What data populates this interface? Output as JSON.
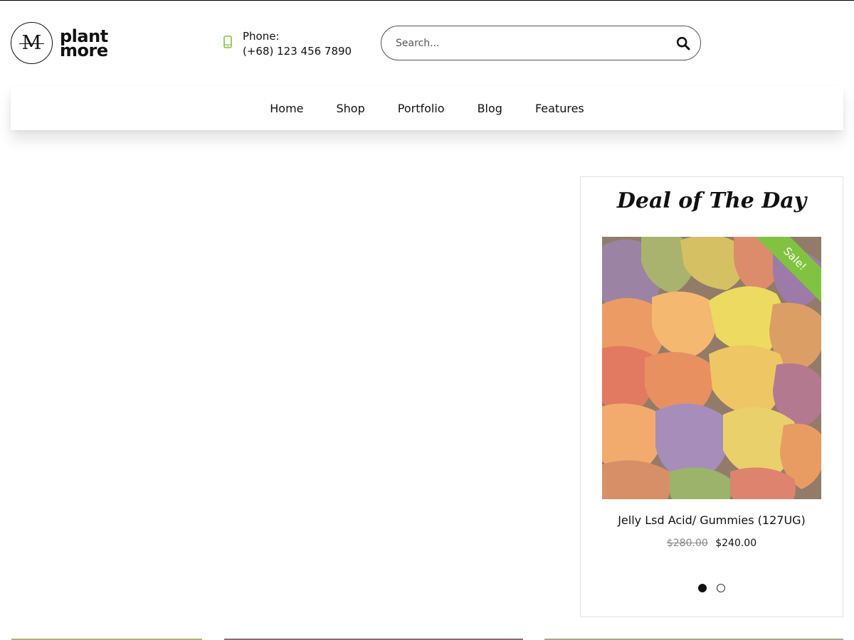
{
  "brand": {
    "logo_letter": "M",
    "name_line1": "plant",
    "name_line2": "more"
  },
  "contact": {
    "label": "Phone:",
    "number": "(+68) 123 456 7890",
    "icon": "mobile-phone-icon"
  },
  "search": {
    "placeholder": "Search...",
    "icon": "search-icon"
  },
  "nav": {
    "items": [
      "Home",
      "Shop",
      "Portfolio",
      "Blog",
      "Features"
    ]
  },
  "deal": {
    "title": "Deal of The Day",
    "badge": "Sale!",
    "product_name": "Jelly Lsd Acid/ Gummies (127UG)",
    "old_price": "$280.00",
    "new_price": "$240.00",
    "slides": {
      "count": 2,
      "active": 1
    }
  },
  "colors": {
    "accent": "#81c341",
    "text": "#111111",
    "border": "#e2e2e2"
  }
}
